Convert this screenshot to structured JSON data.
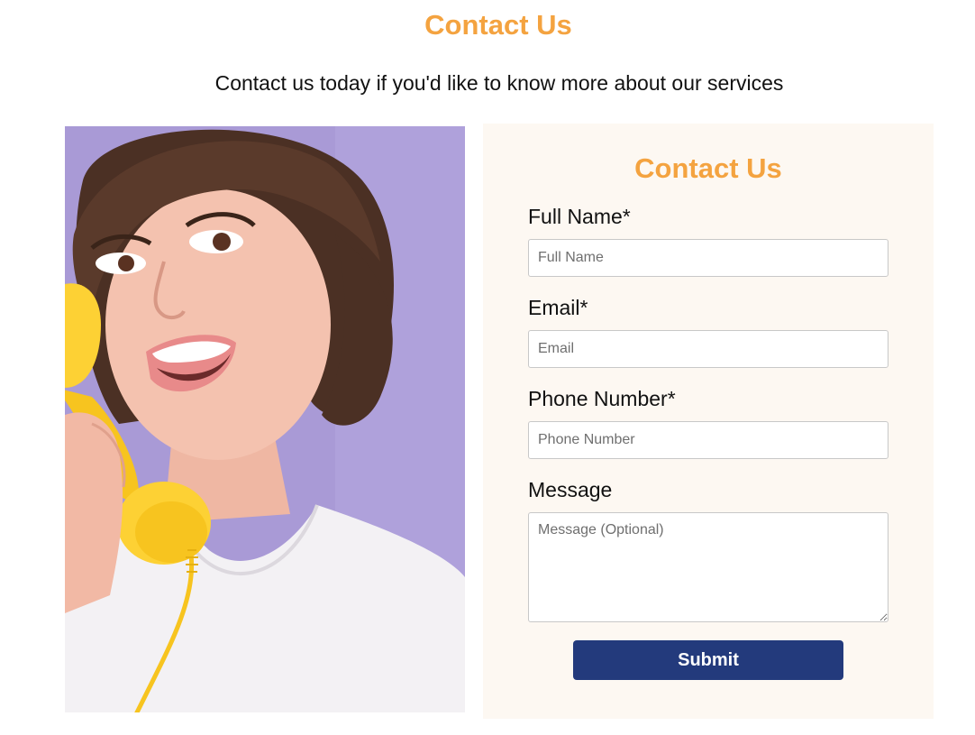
{
  "header": {
    "title": "Contact Us",
    "subtitle": "Contact us today if you'd like to know more about our services"
  },
  "photo": {
    "alt": "Smiling woman talking on a yellow retro telephone"
  },
  "form": {
    "title": "Contact Us",
    "fields": [
      {
        "label": "Full Name*",
        "placeholder": "Full Name",
        "value": ""
      },
      {
        "label": "Email*",
        "placeholder": "Email",
        "value": ""
      },
      {
        "label": "Phone Number*",
        "placeholder": "Phone Number",
        "value": ""
      },
      {
        "label": "Message",
        "placeholder": "Message (Optional)",
        "value": ""
      }
    ],
    "submit_label": "Submit"
  },
  "colors": {
    "accent": "#f4a340",
    "button": "#233a7c",
    "panel_bg": "#fdf8f2",
    "photo_bg": "#a99ad6",
    "phone": "#fdd134"
  }
}
